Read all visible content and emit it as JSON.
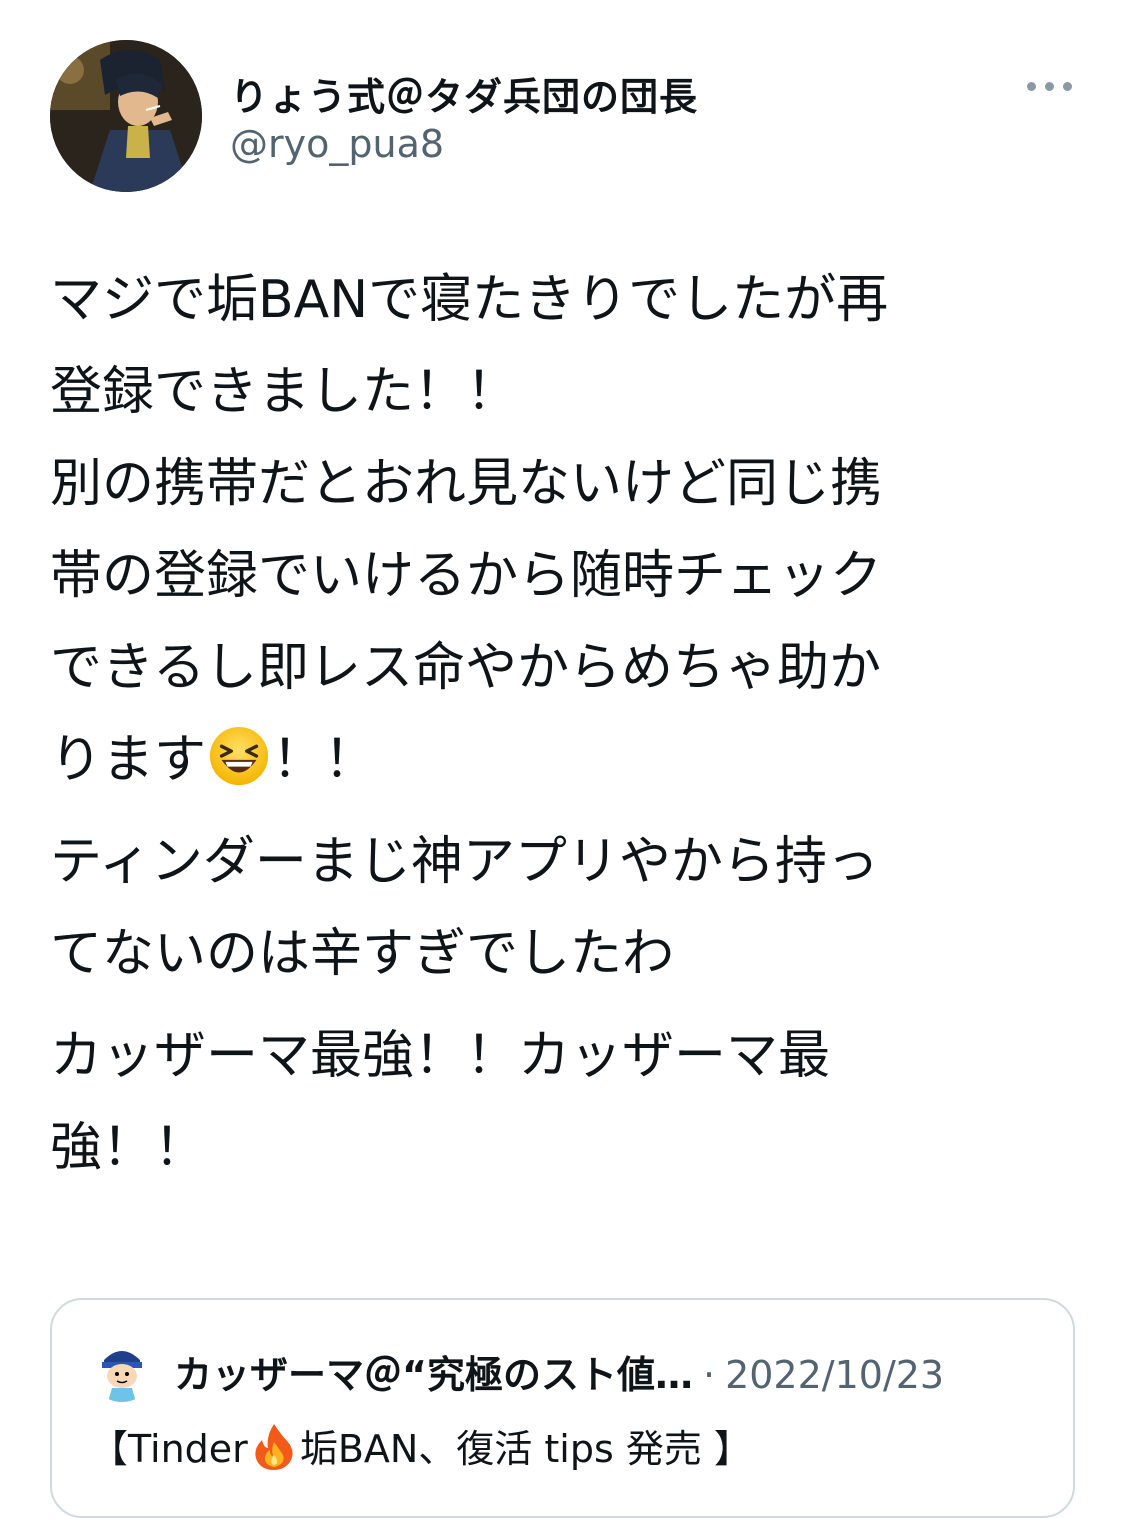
{
  "author": {
    "display_name": "りょう式＠タダ兵団の団長",
    "handle": "@ryo_pua8",
    "avatar_icon": "anime-character-avatar"
  },
  "more_icon": "more-dots-icon",
  "tweet": {
    "paragraph1_before_emoji": "マジで垢BANで寝たきりでしたが再\n登録できました！！\n別の携帯だとおれ見ないけど同じ携\n帯の登録でいけるから随時チェック\nできるし即レス命やからめちゃ助か\nります",
    "emoji": "laughing-face-emoji",
    "paragraph1_after_emoji": "！！",
    "paragraph2": "ティンダーまじ神アプリやから持っ\nてないのは辛すぎでしたわ",
    "paragraph3": "カッザーマ最強！！カッザーマ最\n強！！"
  },
  "quoted_tweet": {
    "author_name": "カッザーマ＠“究極のスト値…",
    "separator": "·",
    "date": "2022/10/23",
    "text_before": "【Tinder",
    "emoji": "fire-emoji",
    "text_after": "垢BAN、復活 tips 発売 】",
    "avatar_icon": "cartoon-boy-avatar"
  },
  "colors": {
    "text": "#0f1419",
    "secondary": "#536471",
    "border": "#cfd9de"
  }
}
